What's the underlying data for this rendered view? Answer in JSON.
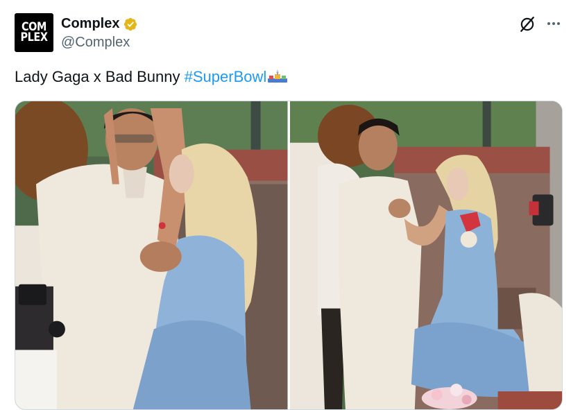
{
  "tweet": {
    "author": {
      "display_name": "Complex",
      "handle": "@Complex",
      "avatar_text": "COM\nPLEX",
      "verified": true,
      "verified_color": "#e2b719"
    },
    "text_prefix": "Lady Gaga x Bad Bunny ",
    "hashtag": "#SuperBowl",
    "hashtag_color": "#1d9bf0",
    "icons": {
      "grok": "grok-icon",
      "more": "more-icon",
      "hashflag": "superbowl-hashflag-icon"
    },
    "media": [
      {
        "description_icon": "photo-1"
      },
      {
        "description_icon": "photo-2"
      }
    ]
  }
}
